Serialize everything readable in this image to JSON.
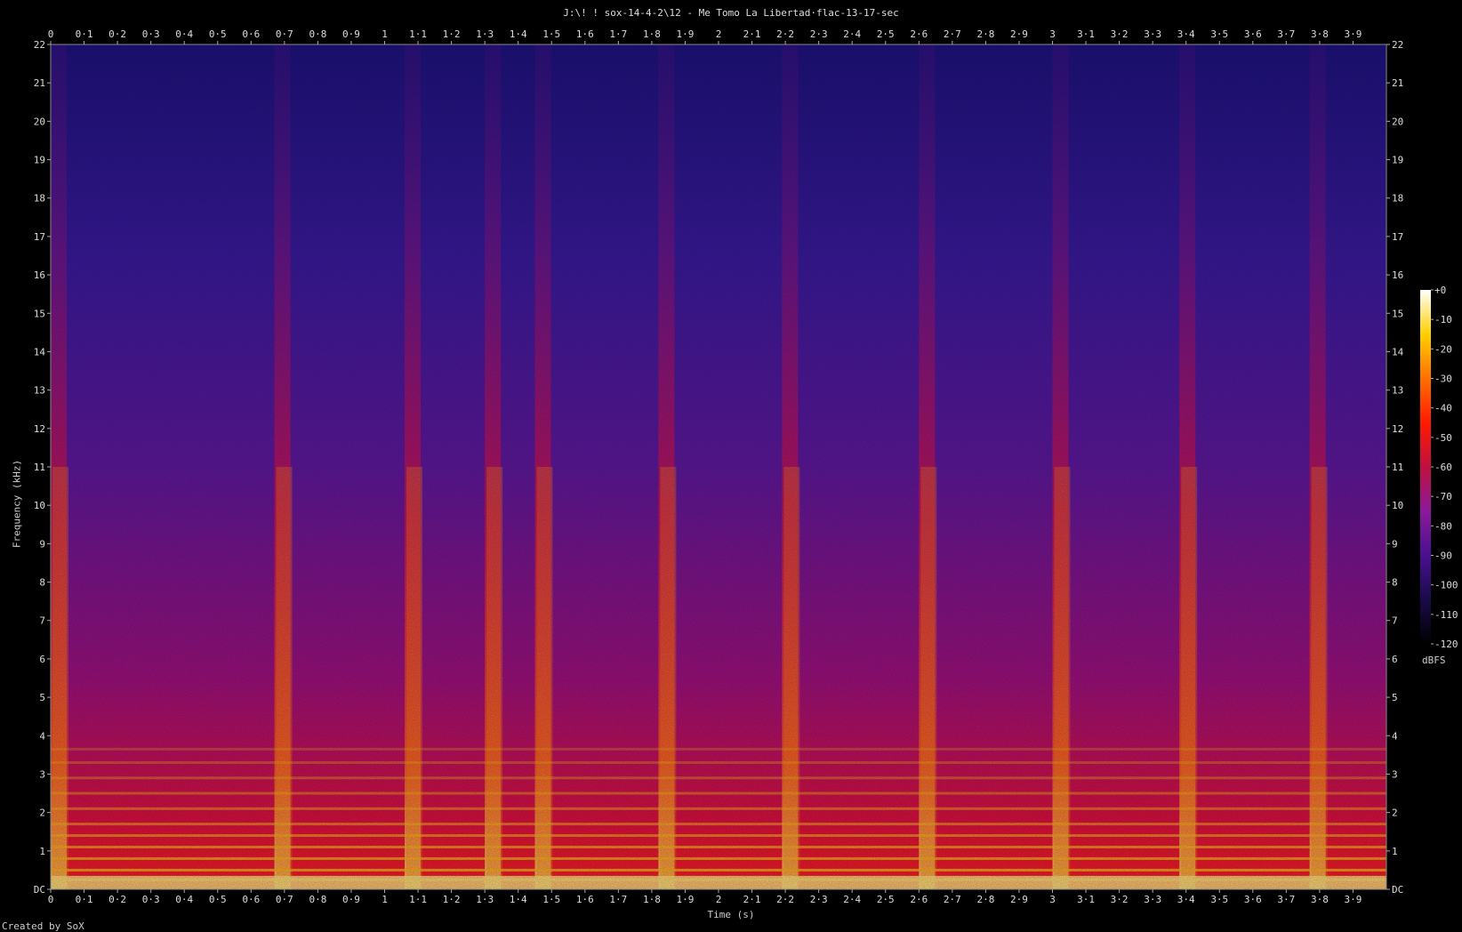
{
  "window": {
    "title": "J:\\! ! sox-14-4-2\\12 - Me Tomo La Libertad·flac-13-17-sec",
    "footer": "Created by SoX"
  },
  "chart_data": {
    "type": "heatmap",
    "title": "J:\\! ! sox-14-4-2\\12 - Me Tomo La Libertad·flac-13-17-sec",
    "xlabel": "Time (s)",
    "ylabel": "Frequency (kHz)",
    "xlim": [
      0,
      4.0
    ],
    "ylim": [
      0,
      22
    ],
    "x_ticks": [
      "0",
      "0·1",
      "0·2",
      "0·3",
      "0·4",
      "0·5",
      "0·6",
      "0·7",
      "0·8",
      "0·9",
      "1",
      "1·1",
      "1·2",
      "1·3",
      "1·4",
      "1·5",
      "1·6",
      "1·7",
      "1·8",
      "1·9",
      "2",
      "2·1",
      "2·2",
      "2·3",
      "2·4",
      "2·5",
      "2·6",
      "2·7",
      "2·8",
      "2·9",
      "3",
      "3·1",
      "3·2",
      "3·3",
      "3·4",
      "3·5",
      "3·6",
      "3·7",
      "3·8",
      "3·9"
    ],
    "y_ticks": [
      "DC",
      "1",
      "2",
      "3",
      "4",
      "5",
      "6",
      "7",
      "8",
      "9",
      "10",
      "11",
      "12",
      "13",
      "14",
      "15",
      "16",
      "17",
      "18",
      "19",
      "20",
      "21",
      "22"
    ],
    "colorbar": {
      "unit": "dBFS",
      "ticks": [
        "+0",
        "-10",
        "-20",
        "-30",
        "-40",
        "-50",
        "-60",
        "-70",
        "-80",
        "-90",
        "-100",
        "-110",
        "-120"
      ],
      "range_db": [
        -120,
        0
      ],
      "colors": [
        "#000000",
        "#1a0a4a",
        "#4a1090",
        "#8a1a9a",
        "#c01040",
        "#ff1a00",
        "#ff7000",
        "#ffd000",
        "#ffffff"
      ]
    },
    "onsets_s": [
      0.0,
      0.67,
      1.06,
      1.3,
      1.45,
      1.82,
      2.19,
      2.6,
      3.0,
      3.38,
      3.77
    ],
    "sustained_harmonics_khz": [
      0.25,
      0.5,
      0.8,
      1.1,
      1.4,
      1.7,
      2.1,
      2.5,
      2.9,
      3.3,
      3.65
    ]
  }
}
